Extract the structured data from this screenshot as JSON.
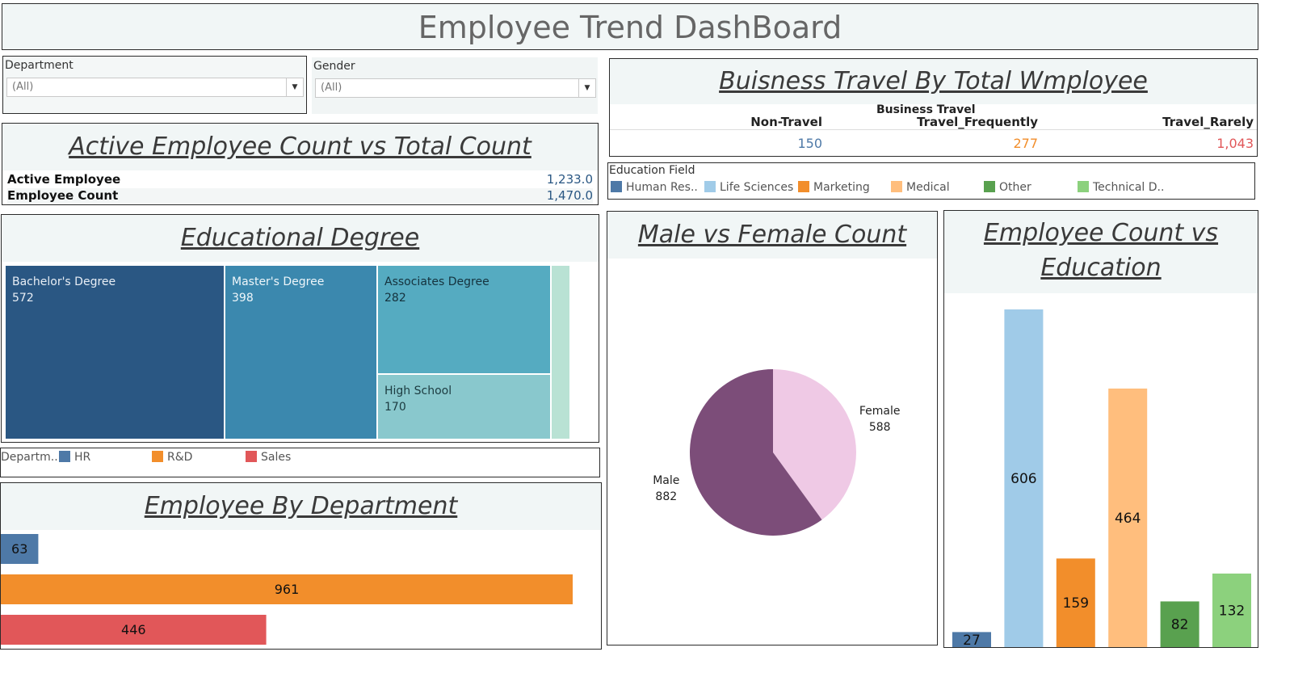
{
  "title": "Employee Trend DashBoard",
  "filters": {
    "department": {
      "label": "Department",
      "value": "(All)"
    },
    "gender": {
      "label": "Gender",
      "value": "(All)"
    }
  },
  "active_card": {
    "title": "Active Employee Count vs Total Count",
    "rows": [
      {
        "label": "Active Employee",
        "value": "1,233.0"
      },
      {
        "label": "Employee Count",
        "value": "1,470.0"
      }
    ]
  },
  "travel_card": {
    "title": "Buisness Travel By Total Wmployee",
    "header": "Business Travel",
    "columns": [
      {
        "label": "Non-Travel",
        "value": "150",
        "color": "#4e79a7"
      },
      {
        "label": "Travel_Frequently",
        "value": "277",
        "color": "#f28e2b"
      },
      {
        "label": "Travel_Rarely",
        "value": "1,043",
        "color": "#e15759"
      }
    ]
  },
  "education_legend": {
    "title": "Education Field",
    "items": [
      {
        "label": "Human Res..",
        "color": "#4e79a7"
      },
      {
        "label": "Life Sciences",
        "color": "#a0cbe8"
      },
      {
        "label": "Marketing",
        "color": "#f28e2b"
      },
      {
        "label": "Medical",
        "color": "#ffbe7d"
      },
      {
        "label": "Other",
        "color": "#59a14f"
      },
      {
        "label": "Technical D..",
        "color": "#8cd17d"
      }
    ]
  },
  "degree_card": {
    "title": "Educational Degree",
    "tiles": [
      {
        "label": "Bachelor's Degree",
        "value": "572",
        "color": "#2a5783"
      },
      {
        "label": "Master's Degree",
        "value": "398",
        "color": "#3b88ae"
      },
      {
        "label": "Associates Degree",
        "value": "282",
        "color": "#55abc1"
      },
      {
        "label": "High School",
        "value": "170",
        "color": "#89c8cd"
      },
      {
        "label": "",
        "value": "",
        "color": "#b9e2d4"
      }
    ]
  },
  "dept_legend": {
    "title": "Departm..",
    "items": [
      {
        "label": "HR",
        "color": "#4e79a7"
      },
      {
        "label": "R&D",
        "color": "#f28e2b"
      },
      {
        "label": "Sales",
        "color": "#e15759"
      }
    ]
  },
  "charts": {
    "gender": {
      "title": "Male vs Female Count",
      "chart_data": {
        "type": "pie",
        "slices": [
          {
            "label": "Female",
            "value": 588,
            "color": "#efc9e5"
          },
          {
            "label": "Male",
            "value": 882,
            "color": "#7c4d79"
          }
        ]
      }
    },
    "department": {
      "title": "Employee By Department",
      "chart_data": {
        "type": "bar",
        "orientation": "horizontal",
        "categories": [
          "HR",
          "R&D",
          "Sales"
        ],
        "values": [
          63,
          961,
          446
        ],
        "colors": [
          "#4e79a7",
          "#f28e2b",
          "#e15759"
        ]
      }
    },
    "education": {
      "title": "Employee Count vs Education",
      "chart_data": {
        "type": "bar",
        "categories": [
          "Human Res..",
          "Life Sciences",
          "Marketing",
          "Medical",
          "Other",
          "Technical D.."
        ],
        "values": [
          27,
          606,
          159,
          464,
          82,
          132
        ],
        "colors": [
          "#4e79a7",
          "#a0cbe8",
          "#f28e2b",
          "#ffbe7d",
          "#59a14f",
          "#8cd17d"
        ]
      }
    }
  }
}
